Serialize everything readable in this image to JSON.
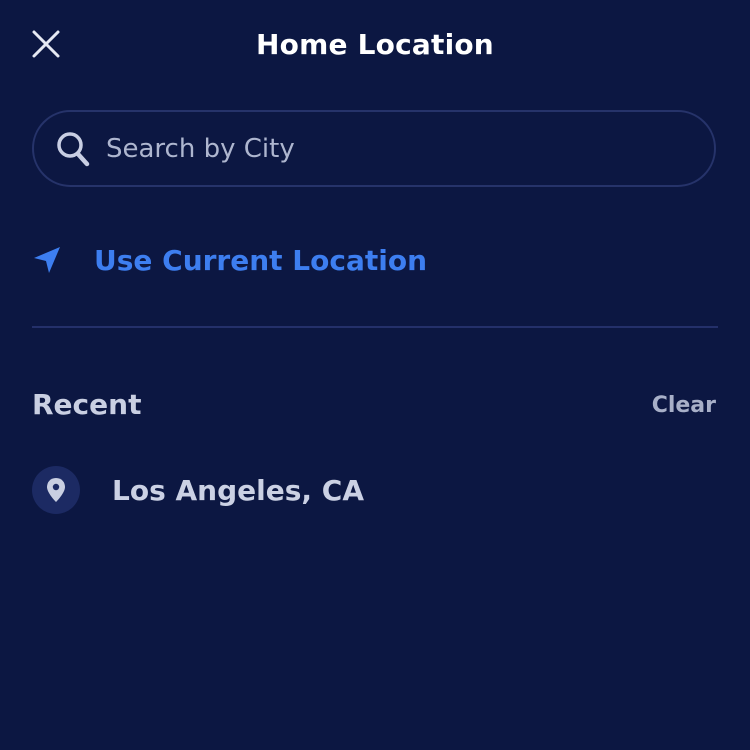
{
  "header": {
    "title": "Home Location",
    "close_icon": "close-icon"
  },
  "search": {
    "placeholder": "Search by City",
    "value": "",
    "icon": "search-icon"
  },
  "current_location": {
    "label": "Use Current Location",
    "icon": "location-arrow-icon"
  },
  "recent": {
    "title": "Recent",
    "clear_label": "Clear",
    "items": [
      {
        "label": "Los Angeles, CA",
        "icon": "map-pin-icon"
      }
    ]
  },
  "colors": {
    "background": "#0c1742",
    "accent": "#3d7ef0",
    "divider": "#24306a",
    "text_primary": "#ffffff",
    "text_secondary": "#c9cfe2"
  }
}
